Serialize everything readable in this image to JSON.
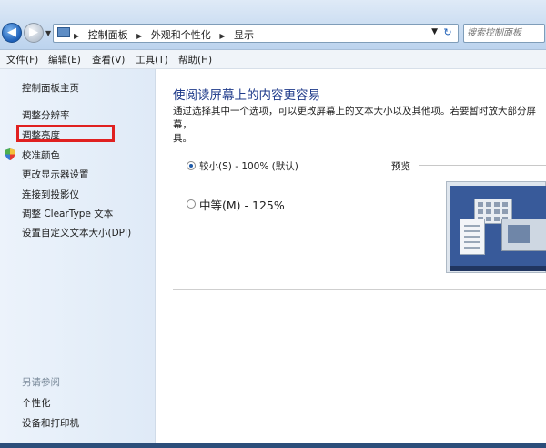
{
  "address": {
    "breadcrumbs": [
      "控制面板",
      "外观和个性化",
      "显示"
    ],
    "search_placeholder": "搜索控制面板"
  },
  "menu": [
    "文件(F)",
    "编辑(E)",
    "查看(V)",
    "工具(T)",
    "帮助(H)"
  ],
  "sidebar": {
    "items": [
      {
        "label": "控制面板主页"
      },
      {
        "label": "调整分辨率"
      },
      {
        "label": "调整亮度",
        "highlighted": true
      },
      {
        "label": "校准颜色",
        "icon": "shield-icon"
      },
      {
        "label": "更改显示器设置"
      },
      {
        "label": "连接到投影仪"
      },
      {
        "label": "调整 ClearType 文本"
      },
      {
        "label": "设置自定义文本大小(DPI)"
      }
    ],
    "see_also_title": "另请参阅",
    "see_also": [
      {
        "label": "个性化"
      },
      {
        "label": "设备和打印机"
      }
    ]
  },
  "main": {
    "title": "使阅读屏幕上的内容更容易",
    "description": "通过选择其中一个选项，可以更改屏幕上的文本大小以及其他项。若要暂时放大部分屏幕，请使用放大镜工具。",
    "description_visible": "通过选择其中一个选项，可以更改屏幕上的文本大小以及其他项。若要暂时放大部分屏幕，",
    "description_line2": "具。",
    "options": [
      {
        "label": "较小(S) - 100% (默认)",
        "selected": true
      },
      {
        "label": "中等(M) - 125%",
        "selected": false
      }
    ],
    "preview_label": "预览"
  },
  "colors": {
    "highlight_box": "#e02020",
    "title_blue": "#1e3a8a"
  }
}
